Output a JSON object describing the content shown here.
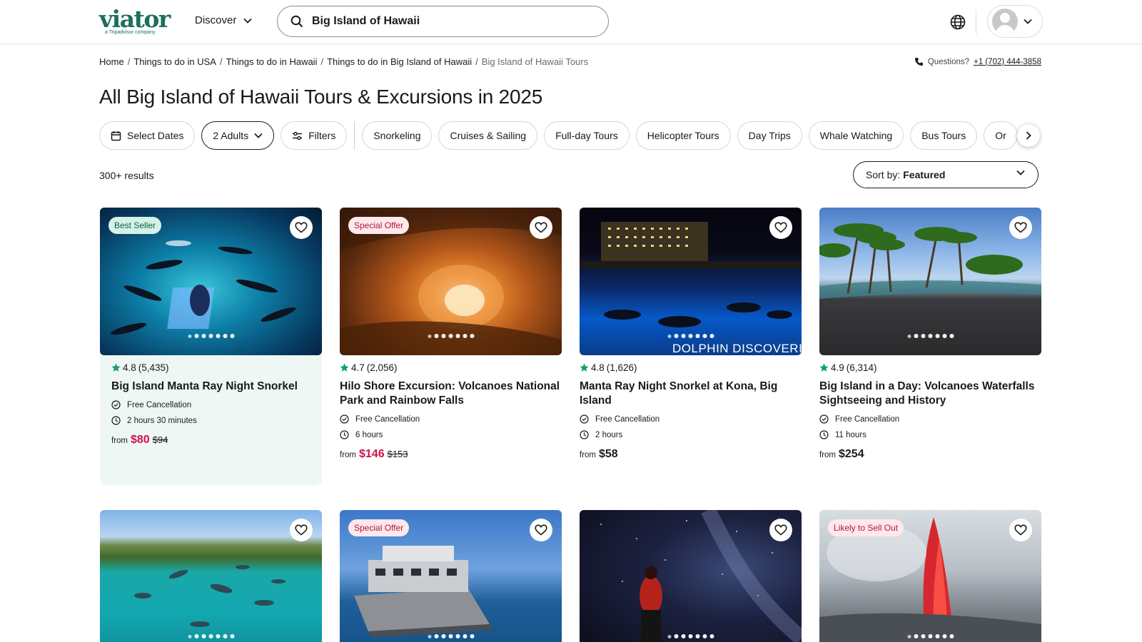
{
  "header": {
    "logo_text": "viator",
    "logo_sub": "a Tripadvisor company",
    "discover_label": "Discover",
    "search_value": "Big Island of Hawaii"
  },
  "breadcrumb": [
    "Home",
    "Things to do in USA",
    "Things to do in Hawaii",
    "Things to do in Big Island of Hawaii",
    "Big Island of Hawaii Tours"
  ],
  "questions": {
    "label": "Questions?",
    "phone": "+1 (702) 444-3858"
  },
  "page_title": "All Big Island of Hawaii Tours & Excursions in 2025",
  "filters": {
    "select_dates": "Select Dates",
    "travelers": "2 Adults",
    "filters": "Filters",
    "categories": [
      "Snorkeling",
      "Cruises & Sailing",
      "Full-day Tours",
      "Helicopter Tours",
      "Day Trips",
      "Whale Watching",
      "Bus Tours",
      "Or"
    ]
  },
  "results_count": "300+ results",
  "sort": {
    "label": "Sort by:",
    "value": "Featured"
  },
  "cards": [
    {
      "badge": "Best Seller",
      "rating": "4.8",
      "reviews": "(5,435)",
      "title": "Big Island Manta Ray Night Snorkel",
      "features": [
        "Free Cancellation",
        "2 hours 30 minutes"
      ],
      "from": "from",
      "price": "$80",
      "was": "$94"
    },
    {
      "badge": "Special Offer",
      "rating": "4.7",
      "reviews": "(2,056)",
      "title": "Hilo Shore Excursion: Volcanoes National Park and Rainbow Falls",
      "features": [
        "Free Cancellation",
        "6 hours"
      ],
      "from": "from",
      "price": "$146",
      "was": "$153"
    },
    {
      "badge": "",
      "image_caption": "DOLPHIN DISCOVERI",
      "rating": "4.8",
      "reviews": "(1,626)",
      "title": "Manta Ray Night Snorkel at Kona, Big Island",
      "features": [
        "Free Cancellation",
        "2 hours"
      ],
      "from": "from",
      "price": "$58",
      "was": ""
    },
    {
      "badge": "",
      "rating": "4.9",
      "reviews": "(6,314)",
      "title": "Big Island in a Day: Volcanoes Waterfalls Sightseeing and History",
      "features": [
        "Free Cancellation",
        "11 hours"
      ],
      "from": "from",
      "price": "$254",
      "was": ""
    }
  ],
  "cards_row2": [
    {
      "badge": ""
    },
    {
      "badge": "Special Offer"
    },
    {
      "badge": ""
    },
    {
      "badge": "Likely to Sell Out"
    }
  ],
  "colors": {
    "brand": "#1d6e5d",
    "sale_price": "#d11149",
    "star": "#0fa06f"
  }
}
